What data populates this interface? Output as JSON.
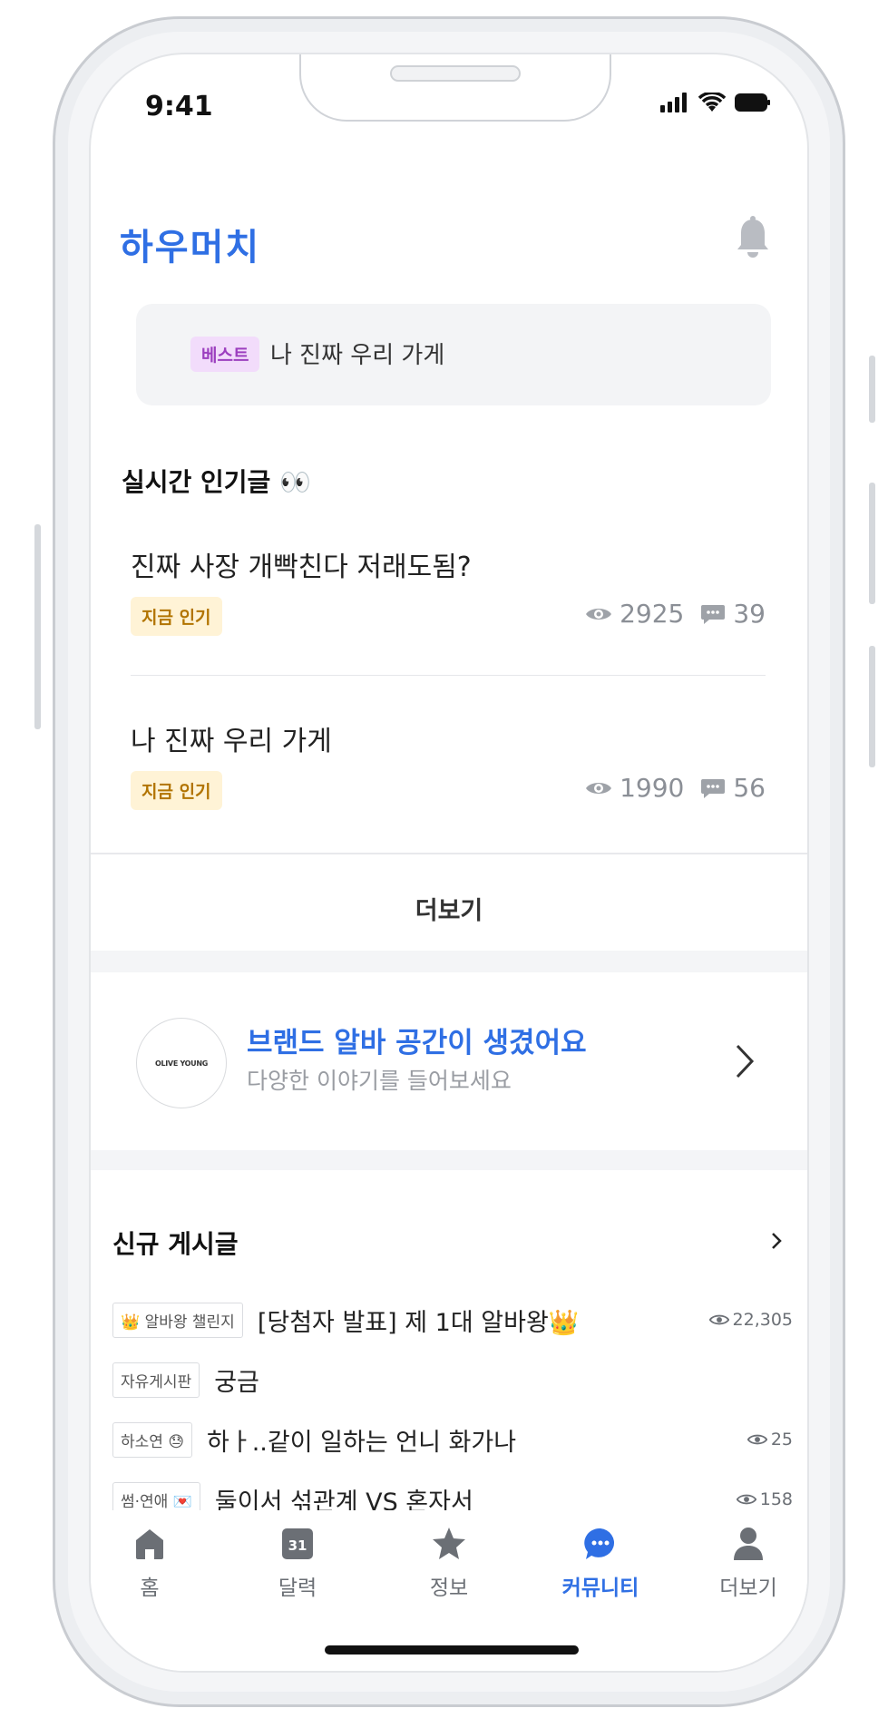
{
  "status": {
    "time": "9:41"
  },
  "header": {
    "app_title": "하우머치"
  },
  "banner": {
    "badge": "베스트",
    "text": "나 진짜 우리 가게"
  },
  "popular": {
    "title": "실시간 인기글 👀",
    "posts": [
      {
        "title": "진짜 사장 개빡친다 저래도됨?",
        "tag": "지금 인기",
        "views": "2925",
        "comments": "39"
      },
      {
        "title": "나 진짜 우리 가게",
        "tag": "지금 인기",
        "views": "1990",
        "comments": "56"
      }
    ],
    "more_label": "더보기"
  },
  "brand": {
    "logo_text": "OLIVE YOUNG",
    "title": "브랜드 알바 공간이 생겼어요",
    "subtitle": "다양한 이야기를 들어보세요"
  },
  "new_posts": {
    "title": "신규 게시글",
    "items": [
      {
        "category": "👑 알바왕 챌린지",
        "title": "[당첨자 발표] 제 1대 알바왕👑",
        "views": "22,305"
      },
      {
        "category": "자유게시판",
        "title": "궁금",
        "views": ""
      },
      {
        "category": "하소연 😓",
        "title": "하ㅏ..같이 일하는 언니 화가나",
        "views": "25"
      },
      {
        "category": "썸·연애 💌",
        "title": "둘이서 섞관계 VS 혼자서",
        "views": "158"
      }
    ]
  },
  "tabs": [
    {
      "label": "홈",
      "icon": "home-icon"
    },
    {
      "label": "달력",
      "icon": "calendar-icon",
      "icon_text": "31"
    },
    {
      "label": "정보",
      "icon": "star-icon"
    },
    {
      "label": "커뮤니티",
      "icon": "chat-icon",
      "active": true
    },
    {
      "label": "더보기",
      "icon": "person-icon"
    }
  ],
  "colors": {
    "accent": "#2f6fe4",
    "best_badge": "#f2dcfb",
    "hot_badge": "#fff3d6"
  }
}
